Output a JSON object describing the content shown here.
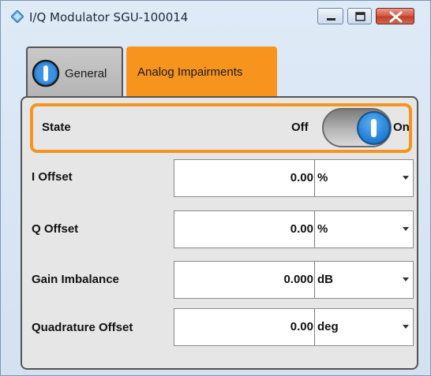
{
  "window": {
    "title": "I/Q Modulator SGU-100014",
    "controls": [
      "minimize-icon",
      "maximize-icon",
      "close-icon"
    ]
  },
  "tabs": [
    {
      "label": "General",
      "active": false,
      "icon": "power-icon"
    },
    {
      "label": "Analog Impairments",
      "active": true
    }
  ],
  "state": {
    "label": "State",
    "off_label": "Off",
    "on_label": "On",
    "value": "On"
  },
  "fields": [
    {
      "label": "I Offset",
      "value": "0.00",
      "unit": "%"
    },
    {
      "label": "Q Offset",
      "value": "0.00",
      "unit": "%"
    },
    {
      "label": "Gain Imbalance",
      "value": "0.000",
      "unit": "dB"
    },
    {
      "label": "Quadrature Offset",
      "value": "0.00",
      "unit": "deg"
    }
  ],
  "colors": {
    "accent": "#f7941d",
    "toggle_on": "#2b86d9"
  }
}
